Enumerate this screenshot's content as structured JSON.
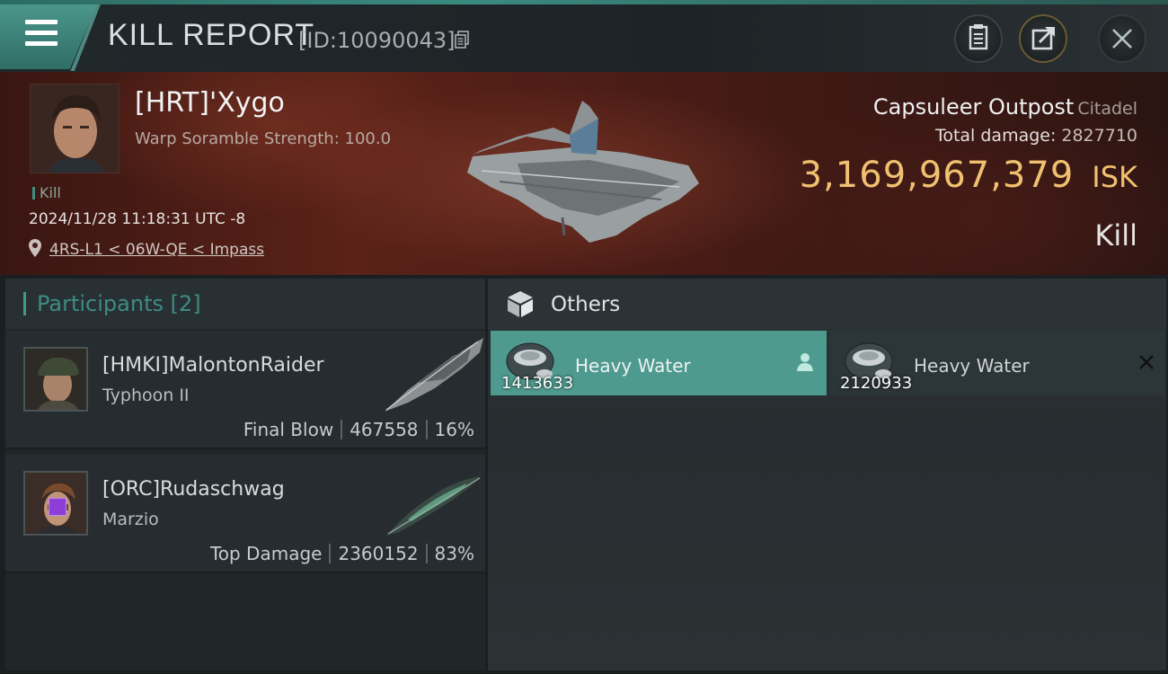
{
  "header": {
    "title": "KILL REPORT",
    "report_id": "[ID:10090043]"
  },
  "victim": {
    "pilot_name": "[HRT]'Xygo",
    "scramble": "Warp Soramble Strength: 100.0",
    "kill_tag": "Kill",
    "datetime": "2024/11/28 11:18:31 UTC -8",
    "location": "4RS-L1 < 06W-QE < Impass",
    "ship_name": "Capsuleer Outpost",
    "ship_class": "Citadel",
    "total_damage_label": "Total damage:",
    "total_damage": "2827710",
    "isk_value": "3,169,967,379",
    "isk_unit": "ISK",
    "result": "Kill"
  },
  "participants": {
    "label": "Participants",
    "count": "[2]",
    "rows": [
      {
        "name": "[HMKI]MalontonRaider",
        "ship": "Typhoon II",
        "role": "Final Blow",
        "damage": "467558",
        "percent": "16%"
      },
      {
        "name": "[ORC]Rudaschwag",
        "ship": "Marzio",
        "role": "Top Damage",
        "damage": "2360152",
        "percent": "83%"
      }
    ]
  },
  "others": {
    "label": "Others",
    "items": [
      {
        "name": "Heavy Water",
        "qty": "1413633"
      },
      {
        "name": "Heavy Water",
        "qty": "2120933"
      }
    ]
  },
  "colors": {
    "accent_teal": "#4f9a8f",
    "isk_gold": "#f0c170",
    "hero_red": "#5a2218"
  }
}
